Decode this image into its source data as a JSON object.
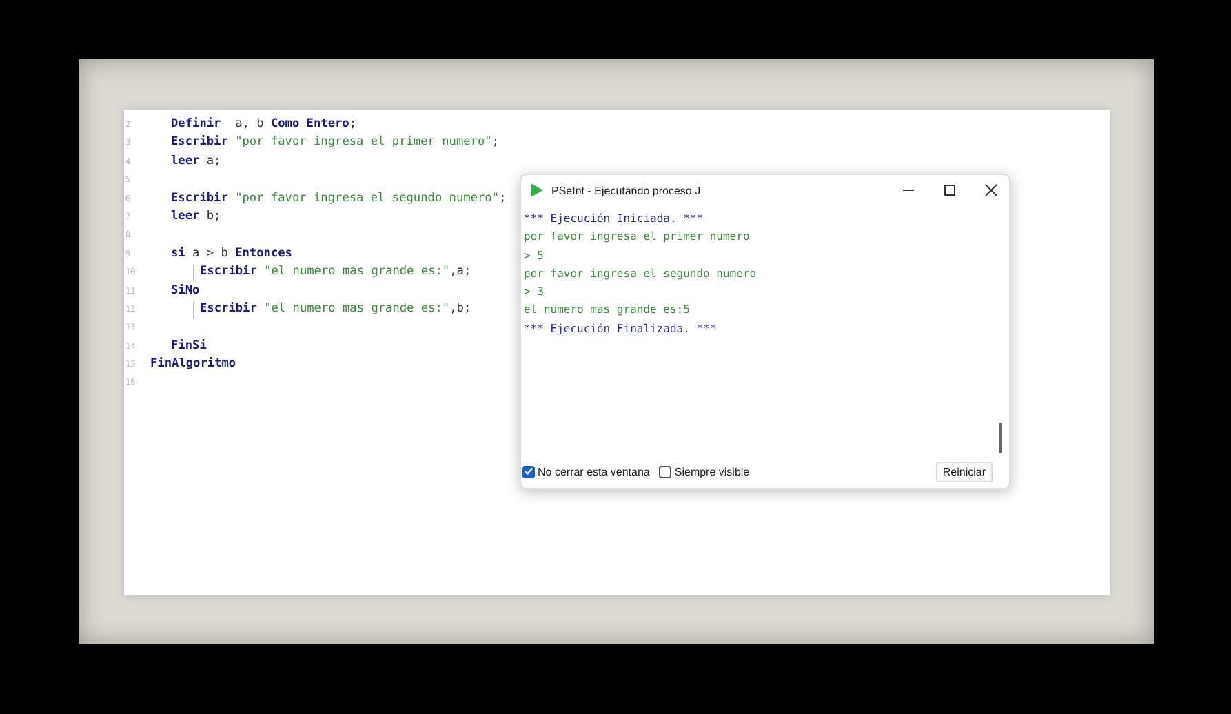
{
  "editor": {
    "line_numbers": [
      "2",
      "3",
      "4",
      "5",
      "6",
      "7",
      "8",
      "9",
      "10",
      "11",
      "12",
      "13",
      "14",
      "15",
      "16"
    ],
    "lines": [
      {
        "kind": "block",
        "tokens": [
          {
            "kind": "keyword",
            "text": "Definir"
          },
          {
            "kind": "plain",
            "text": "  a, b "
          },
          {
            "kind": "keyword",
            "text": "Como Entero"
          },
          {
            "kind": "plain",
            "text": ";"
          }
        ]
      },
      {
        "kind": "block",
        "tokens": [
          {
            "kind": "keyword",
            "text": "Escribir"
          },
          {
            "kind": "string",
            "text": " \"por favor ingresa el primer numero\""
          },
          {
            "kind": "plain",
            "text": ";"
          }
        ]
      },
      {
        "kind": "block",
        "tokens": [
          {
            "kind": "keyword",
            "text": "leer"
          },
          {
            "kind": "plain",
            "text": " a;"
          }
        ]
      },
      {
        "kind": "blank"
      },
      {
        "kind": "block",
        "tokens": [
          {
            "kind": "keyword",
            "text": "Escribir"
          },
          {
            "kind": "string",
            "text": " \"por favor ingresa el segundo numero\""
          },
          {
            "kind": "plain",
            "text": ";"
          }
        ]
      },
      {
        "kind": "block",
        "tokens": [
          {
            "kind": "keyword",
            "text": "leer"
          },
          {
            "kind": "plain",
            "text": " b;"
          }
        ]
      },
      {
        "kind": "blank"
      },
      {
        "kind": "block",
        "tokens": [
          {
            "kind": "keyword",
            "text": "si"
          },
          {
            "kind": "plain",
            "text": " a > b "
          },
          {
            "kind": "keyword",
            "text": "Entonces"
          }
        ]
      },
      {
        "kind": "nested",
        "tokens": [
          {
            "kind": "keyword",
            "text": "Escribir"
          },
          {
            "kind": "string",
            "text": " \"el numero mas grande es:\""
          },
          {
            "kind": "plain",
            "text": ",a;"
          }
        ]
      },
      {
        "kind": "block",
        "tokens": [
          {
            "kind": "keyword",
            "text": "SiNo"
          }
        ]
      },
      {
        "kind": "nested",
        "tokens": [
          {
            "kind": "keyword",
            "text": "Escribir"
          },
          {
            "kind": "string",
            "text": " \"el numero mas grande es:\""
          },
          {
            "kind": "plain",
            "text": ",b;"
          }
        ]
      },
      {
        "kind": "blank"
      },
      {
        "kind": "block",
        "tokens": [
          {
            "kind": "keyword",
            "text": "FinSi"
          }
        ]
      },
      {
        "kind": "top",
        "tokens": [
          {
            "kind": "keyword",
            "text": "FinAlgoritmo"
          }
        ]
      },
      {
        "kind": "blank"
      }
    ]
  },
  "console_window": {
    "title": "PSeInt - Ejecutando proceso J",
    "output": [
      {
        "kind": "info",
        "text": "*** Ejecución Iniciada. ***"
      },
      {
        "kind": "output",
        "text": "por favor ingresa el primer numero"
      },
      {
        "kind": "input",
        "text": "> 5"
      },
      {
        "kind": "output",
        "text": "por favor ingresa el segundo numero"
      },
      {
        "kind": "input",
        "text": "> 3"
      },
      {
        "kind": "output",
        "text": "el numero mas grande es:5"
      },
      {
        "kind": "info",
        "text": "*** Ejecución Finalizada. ***"
      }
    ],
    "options": [
      {
        "label": "No cerrar esta ventana",
        "checked": true
      },
      {
        "label": "Siempre visible",
        "checked": false
      }
    ],
    "button": "Reiniciar"
  }
}
